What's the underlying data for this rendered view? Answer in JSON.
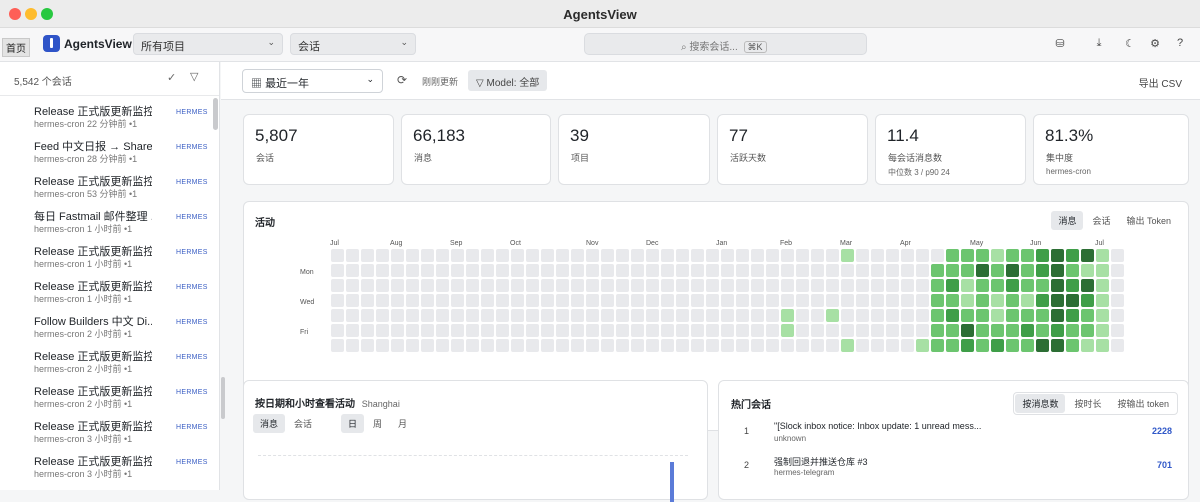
{
  "window": {
    "title": "AgentsView"
  },
  "appbar": {
    "home_tooltip": "首页",
    "brand": "AgentsView",
    "project_select": "所有项目",
    "type_select": "会话",
    "search_placeholder": "搜索会话...",
    "search_shortcut": "⌘K",
    "icons": [
      "database-icon",
      "download-icon",
      "moon-icon",
      "gear-icon",
      "help-icon"
    ]
  },
  "sidebar": {
    "count": "5,542 个会话",
    "sessions": [
      {
        "title": "Release 正式版更新监控...",
        "meta": "hermes-cron  22 分钟前  •1",
        "agent": "HERMES"
      },
      {
        "title": "Feed 中文日报 → Share...",
        "meta": "hermes-cron  28 分钟前  •1",
        "agent": "HERMES"
      },
      {
        "title": "Release 正式版更新监控...",
        "meta": "hermes-cron  53 分钟前  •1",
        "agent": "HERMES"
      },
      {
        "title": "每日 Fastmail 邮件整理 ...",
        "meta": "hermes-cron  1 小时前  •1",
        "agent": "HERMES"
      },
      {
        "title": "Release 正式版更新监控...",
        "meta": "hermes-cron  1 小时前  •1",
        "agent": "HERMES"
      },
      {
        "title": "Release 正式版更新监控...",
        "meta": "hermes-cron  1 小时前  •1",
        "agent": "HERMES"
      },
      {
        "title": "Follow Builders 中文 Di...",
        "meta": "hermes-cron  2 小时前  •1",
        "agent": "HERMES"
      },
      {
        "title": "Release 正式版更新监控...",
        "meta": "hermes-cron  2 小时前  •1",
        "agent": "HERMES"
      },
      {
        "title": "Release 正式版更新监控...",
        "meta": "hermes-cron  2 小时前  •1",
        "agent": "HERMES"
      },
      {
        "title": "Release 正式版更新监控...",
        "meta": "hermes-cron  3 小时前  •1",
        "agent": "HERMES"
      },
      {
        "title": "Release 正式版更新监控...",
        "meta": "hermes-cron  3 小时前  •1",
        "agent": "HERMES"
      }
    ]
  },
  "toolbar": {
    "range": "最近一年",
    "refresh_label": "刚刚更新",
    "model_filter": "Model: 全部",
    "export": "导出 CSV"
  },
  "stats": [
    {
      "value": "5,807",
      "label": "会话",
      "sub": ""
    },
    {
      "value": "66,183",
      "label": "消息",
      "sub": ""
    },
    {
      "value": "39",
      "label": "项目",
      "sub": ""
    },
    {
      "value": "77",
      "label": "活跃天数",
      "sub": ""
    },
    {
      "value": "11.4",
      "label": "每会话消息数",
      "sub": "中位数 3 / p90 24"
    },
    {
      "value": "81.3%",
      "label": "集中度",
      "sub": "hermes-cron"
    }
  ],
  "activity": {
    "title": "活动",
    "tabs": [
      "消息",
      "会话",
      "输出 Token"
    ],
    "active_tab": 0,
    "months": [
      "Jul",
      "Aug",
      "Sep",
      "Oct",
      "Nov",
      "Dec",
      "Jan",
      "Feb",
      "Mar",
      "Apr",
      "May",
      "Jun",
      "Jul"
    ],
    "days": [
      "Mon",
      "Wed",
      "Fri"
    ],
    "palette": [
      "#e8e9ec",
      "#a7e0a4",
      "#6cc56f",
      "#3f9e48",
      "#2c6e34"
    ],
    "weeks": 53,
    "active_cells": [
      [
        34,
        0,
        1
      ],
      [
        40,
        1,
        2
      ],
      [
        40,
        2,
        2
      ],
      [
        40,
        3,
        2
      ],
      [
        40,
        4,
        2
      ],
      [
        40,
        5,
        2
      ],
      [
        40,
        6,
        2
      ],
      [
        41,
        0,
        2
      ],
      [
        41,
        1,
        2
      ],
      [
        41,
        2,
        3
      ],
      [
        41,
        3,
        2
      ],
      [
        41,
        4,
        3
      ],
      [
        41,
        5,
        2
      ],
      [
        41,
        6,
        2
      ],
      [
        42,
        0,
        2
      ],
      [
        42,
        1,
        2
      ],
      [
        42,
        2,
        1
      ],
      [
        42,
        3,
        1
      ],
      [
        42,
        4,
        2
      ],
      [
        42,
        5,
        4
      ],
      [
        42,
        6,
        3
      ],
      [
        43,
        0,
        2
      ],
      [
        43,
        1,
        4
      ],
      [
        43,
        2,
        2
      ],
      [
        43,
        3,
        2
      ],
      [
        43,
        4,
        2
      ],
      [
        43,
        5,
        2
      ],
      [
        43,
        6,
        2
      ],
      [
        44,
        0,
        1
      ],
      [
        44,
        1,
        2
      ],
      [
        44,
        2,
        2
      ],
      [
        44,
        3,
        1
      ],
      [
        44,
        4,
        1
      ],
      [
        44,
        5,
        2
      ],
      [
        44,
        6,
        3
      ],
      [
        45,
        0,
        2
      ],
      [
        45,
        1,
        4
      ],
      [
        45,
        2,
        3
      ],
      [
        45,
        3,
        2
      ],
      [
        45,
        4,
        2
      ],
      [
        45,
        5,
        2
      ],
      [
        45,
        6,
        2
      ],
      [
        46,
        0,
        2
      ],
      [
        46,
        1,
        2
      ],
      [
        46,
        2,
        2
      ],
      [
        46,
        3,
        1
      ],
      [
        46,
        4,
        2
      ],
      [
        46,
        5,
        3
      ],
      [
        46,
        6,
        2
      ],
      [
        47,
        0,
        3
      ],
      [
        47,
        1,
        3
      ],
      [
        47,
        2,
        2
      ],
      [
        47,
        3,
        3
      ],
      [
        47,
        4,
        2
      ],
      [
        47,
        5,
        2
      ],
      [
        47,
        6,
        4
      ],
      [
        48,
        0,
        4
      ],
      [
        48,
        1,
        4
      ],
      [
        48,
        2,
        4
      ],
      [
        48,
        3,
        4
      ],
      [
        48,
        4,
        4
      ],
      [
        48,
        5,
        3
      ],
      [
        48,
        6,
        4
      ],
      [
        49,
        0,
        3
      ],
      [
        49,
        1,
        2
      ],
      [
        49,
        2,
        3
      ],
      [
        49,
        3,
        4
      ],
      [
        49,
        4,
        3
      ],
      [
        49,
        5,
        2
      ],
      [
        49,
        6,
        2
      ],
      [
        50,
        0,
        4
      ],
      [
        50,
        1,
        1
      ],
      [
        50,
        2,
        4
      ],
      [
        50,
        3,
        3
      ],
      [
        50,
        4,
        2
      ],
      [
        50,
        5,
        2
      ],
      [
        50,
        6,
        1
      ],
      [
        51,
        0,
        1
      ],
      [
        51,
        1,
        1
      ],
      [
        51,
        2,
        1
      ],
      [
        51,
        3,
        1
      ],
      [
        51,
        4,
        1
      ],
      [
        51,
        5,
        1
      ],
      [
        51,
        6,
        1
      ],
      [
        30,
        4,
        1
      ],
      [
        30,
        5,
        1
      ],
      [
        33,
        4,
        1
      ],
      [
        34,
        6,
        1
      ],
      [
        40,
        6,
        2
      ],
      [
        39,
        6,
        1
      ],
      [
        41,
        6,
        2
      ]
    ]
  },
  "hourly": {
    "title": "按日期和小时查看活动",
    "timezone": "Shanghai",
    "metric_tabs": [
      "消息",
      "会话"
    ],
    "period_tabs": [
      "日",
      "周",
      "月"
    ]
  },
  "hot": {
    "title": "热门会话",
    "tabs": [
      "按消息数",
      "按时长",
      "按输出 token"
    ],
    "rows": [
      {
        "rank": "1",
        "title": "\"[Slock inbox notice: Inbox update: 1 unread mess...",
        "sub": "unknown",
        "count": "2228"
      },
      {
        "rank": "2",
        "title": "强制回退并推送仓库 #3",
        "sub": "hermes-telegram",
        "count": "701"
      }
    ]
  }
}
